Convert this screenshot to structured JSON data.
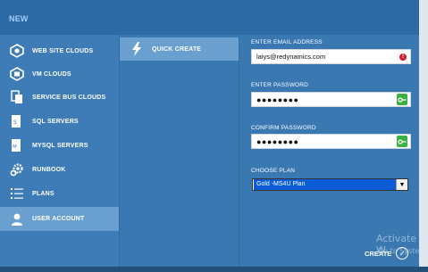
{
  "header": {
    "title": "NEW"
  },
  "nav": {
    "items": [
      {
        "label": "WEB SITE CLOUDS",
        "icon": "web-site-cloud-icon"
      },
      {
        "label": "VM CLOUDS",
        "icon": "vm-cloud-icon"
      },
      {
        "label": "SERVICE BUS CLOUDS",
        "icon": "service-bus-icon"
      },
      {
        "label": "SQL SERVERS",
        "icon": "sql-server-icon"
      },
      {
        "label": "MYSQL SERVERS",
        "icon": "mysql-server-icon"
      },
      {
        "label": "RUNBOOK",
        "icon": "runbook-gear-icon"
      },
      {
        "label": "PLANS",
        "icon": "plans-list-icon"
      },
      {
        "label": "USER ACCOUNT",
        "icon": "user-icon"
      }
    ],
    "active_index": 7
  },
  "submenu": {
    "quick_create": "QUICK CREATE",
    "icon": "lightning-icon"
  },
  "form": {
    "email_label": "ENTER EMAIL ADDRESS",
    "email_value": "laiys@redynamics.com",
    "password_label": "ENTER PASSWORD",
    "password_value": "●●●●●●●●",
    "confirm_label": "CONFIRM PASSWORD",
    "confirm_value": "●●●●●●●●",
    "plan_label": "CHOOSE PLAN",
    "plan_value": "Gold -MS4U Plan",
    "error_glyph": "!",
    "arrow_glyph": "▼"
  },
  "footer": {
    "create_label": "CREATE",
    "create_glyph": "✓"
  },
  "watermark": {
    "line1": "Activate W",
    "line2": "Go to Syste"
  },
  "colors": {
    "background": "#3a78b2",
    "active": "#6aa0cf",
    "error": "#d0202a",
    "key": "#3cb043"
  }
}
